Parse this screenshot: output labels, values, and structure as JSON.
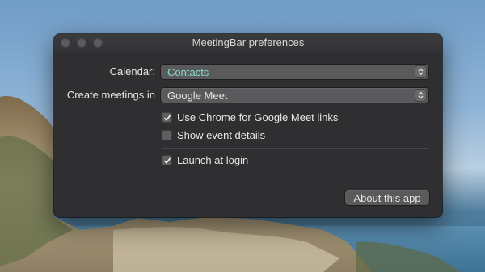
{
  "window": {
    "title": "MeetingBar preferences"
  },
  "calendar": {
    "label": "Calendar:",
    "value": "Contacts",
    "value_color": "#7fe0c8"
  },
  "create_meetings": {
    "label": "Create meetings in",
    "value": "Google Meet"
  },
  "options": {
    "use_chrome": {
      "label": "Use Chrome for Google Meet links",
      "checked": true
    },
    "show_details": {
      "label": "Show event details",
      "checked": false
    },
    "launch_login": {
      "label": "Launch at login",
      "checked": true
    }
  },
  "about_button": {
    "label": "About this app"
  },
  "icons": {
    "checkbox_check": "checkmark-icon",
    "popup_stepper": "updown-chevron-icon"
  }
}
